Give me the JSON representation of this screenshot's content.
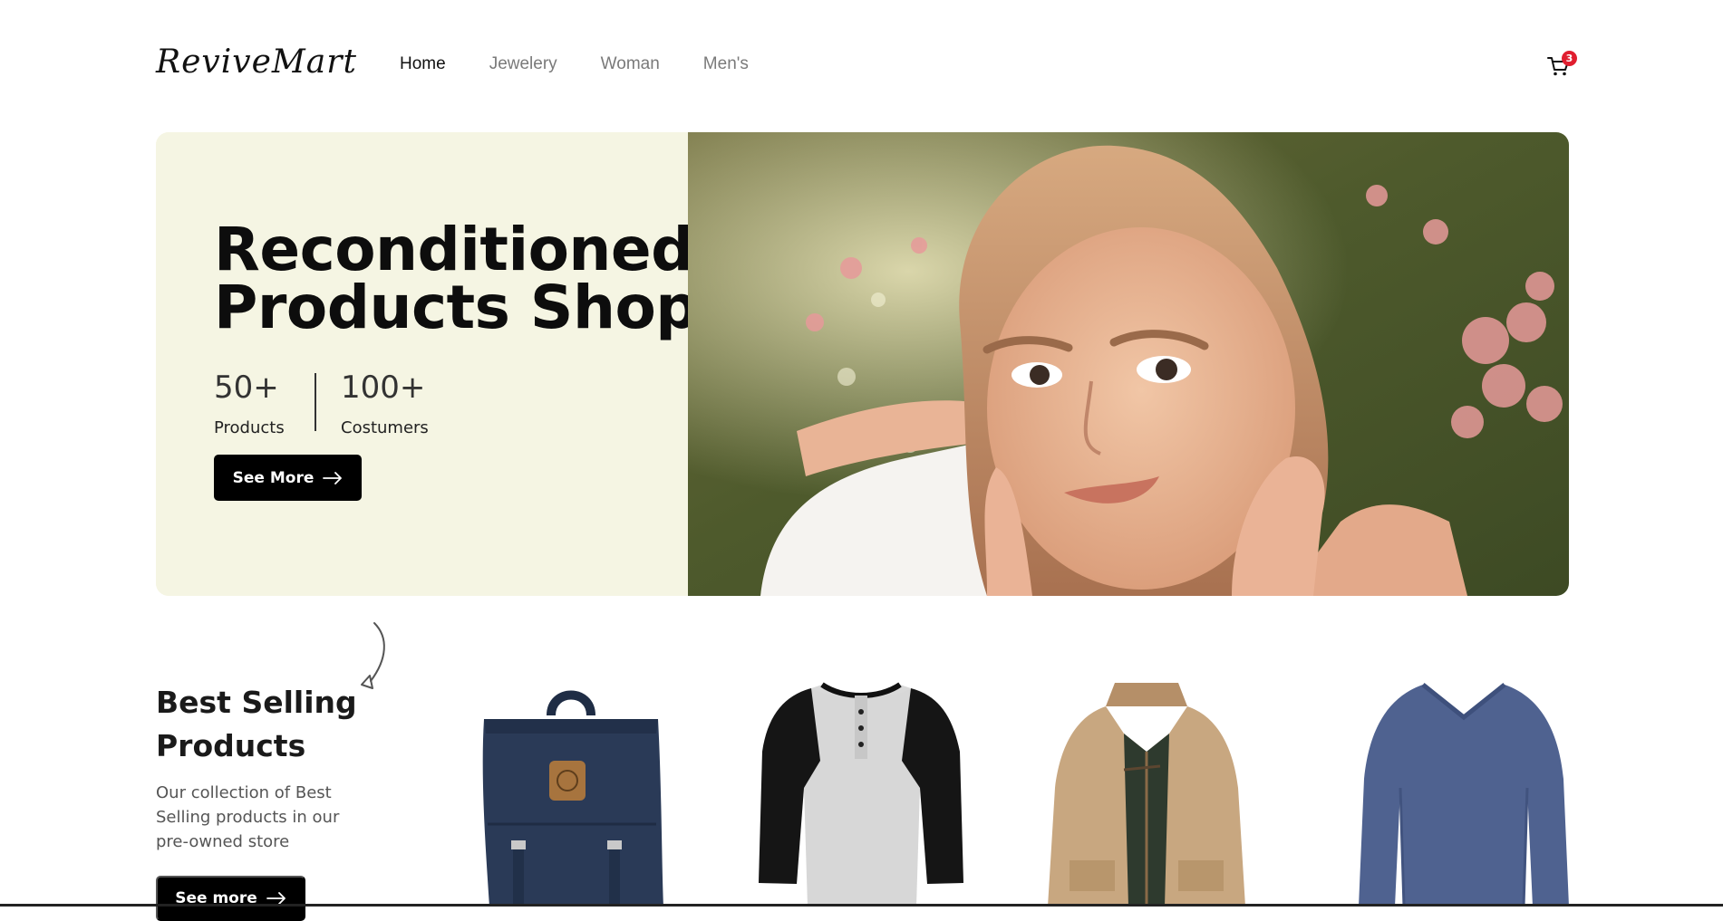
{
  "brand": {
    "name": "ReviveMart"
  },
  "nav": {
    "items": [
      {
        "label": "Home",
        "active": true
      },
      {
        "label": "Jewelery",
        "active": false
      },
      {
        "label": "Woman",
        "active": false
      },
      {
        "label": "Men's",
        "active": false
      }
    ]
  },
  "cart": {
    "icon": "cart-icon",
    "count": "3",
    "badge_color": "#e01e2f"
  },
  "hero": {
    "title_line1": "Reconditioned",
    "title_line2": "Products Shop",
    "stats": [
      {
        "value": "50+",
        "label": "Products"
      },
      {
        "value": "100+",
        "label": "Costumers"
      }
    ],
    "button_label": "See More",
    "button_icon": "arrow-right-icon",
    "background": "#f5f5e3"
  },
  "best_selling": {
    "title_line1": "Best Selling",
    "title_line2": "Products",
    "description": "Our collection of Best Selling products in our pre-owned store",
    "button_label": "See more",
    "button_icon": "arrow-right-icon",
    "products": [
      {
        "name": "navy-backpack-image"
      },
      {
        "name": "raglan-henley-shirt-image"
      },
      {
        "name": "khaki-jacket-image"
      },
      {
        "name": "blue-long-sleeve-shirt-image"
      }
    ]
  }
}
